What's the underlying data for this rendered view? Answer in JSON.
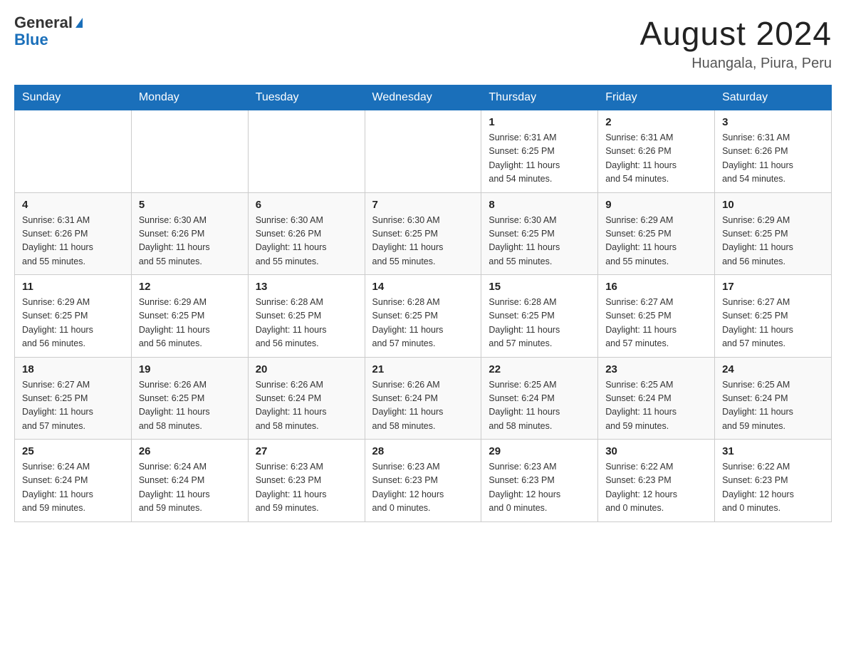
{
  "header": {
    "logo_general": "General",
    "logo_blue": "Blue",
    "month": "August 2024",
    "location": "Huangala, Piura, Peru"
  },
  "weekdays": [
    "Sunday",
    "Monday",
    "Tuesday",
    "Wednesday",
    "Thursday",
    "Friday",
    "Saturday"
  ],
  "weeks": [
    [
      {
        "day": "",
        "info": ""
      },
      {
        "day": "",
        "info": ""
      },
      {
        "day": "",
        "info": ""
      },
      {
        "day": "",
        "info": ""
      },
      {
        "day": "1",
        "info": "Sunrise: 6:31 AM\nSunset: 6:25 PM\nDaylight: 11 hours\nand 54 minutes."
      },
      {
        "day": "2",
        "info": "Sunrise: 6:31 AM\nSunset: 6:26 PM\nDaylight: 11 hours\nand 54 minutes."
      },
      {
        "day": "3",
        "info": "Sunrise: 6:31 AM\nSunset: 6:26 PM\nDaylight: 11 hours\nand 54 minutes."
      }
    ],
    [
      {
        "day": "4",
        "info": "Sunrise: 6:31 AM\nSunset: 6:26 PM\nDaylight: 11 hours\nand 55 minutes."
      },
      {
        "day": "5",
        "info": "Sunrise: 6:30 AM\nSunset: 6:26 PM\nDaylight: 11 hours\nand 55 minutes."
      },
      {
        "day": "6",
        "info": "Sunrise: 6:30 AM\nSunset: 6:26 PM\nDaylight: 11 hours\nand 55 minutes."
      },
      {
        "day": "7",
        "info": "Sunrise: 6:30 AM\nSunset: 6:25 PM\nDaylight: 11 hours\nand 55 minutes."
      },
      {
        "day": "8",
        "info": "Sunrise: 6:30 AM\nSunset: 6:25 PM\nDaylight: 11 hours\nand 55 minutes."
      },
      {
        "day": "9",
        "info": "Sunrise: 6:29 AM\nSunset: 6:25 PM\nDaylight: 11 hours\nand 55 minutes."
      },
      {
        "day": "10",
        "info": "Sunrise: 6:29 AM\nSunset: 6:25 PM\nDaylight: 11 hours\nand 56 minutes."
      }
    ],
    [
      {
        "day": "11",
        "info": "Sunrise: 6:29 AM\nSunset: 6:25 PM\nDaylight: 11 hours\nand 56 minutes."
      },
      {
        "day": "12",
        "info": "Sunrise: 6:29 AM\nSunset: 6:25 PM\nDaylight: 11 hours\nand 56 minutes."
      },
      {
        "day": "13",
        "info": "Sunrise: 6:28 AM\nSunset: 6:25 PM\nDaylight: 11 hours\nand 56 minutes."
      },
      {
        "day": "14",
        "info": "Sunrise: 6:28 AM\nSunset: 6:25 PM\nDaylight: 11 hours\nand 57 minutes."
      },
      {
        "day": "15",
        "info": "Sunrise: 6:28 AM\nSunset: 6:25 PM\nDaylight: 11 hours\nand 57 minutes."
      },
      {
        "day": "16",
        "info": "Sunrise: 6:27 AM\nSunset: 6:25 PM\nDaylight: 11 hours\nand 57 minutes."
      },
      {
        "day": "17",
        "info": "Sunrise: 6:27 AM\nSunset: 6:25 PM\nDaylight: 11 hours\nand 57 minutes."
      }
    ],
    [
      {
        "day": "18",
        "info": "Sunrise: 6:27 AM\nSunset: 6:25 PM\nDaylight: 11 hours\nand 57 minutes."
      },
      {
        "day": "19",
        "info": "Sunrise: 6:26 AM\nSunset: 6:25 PM\nDaylight: 11 hours\nand 58 minutes."
      },
      {
        "day": "20",
        "info": "Sunrise: 6:26 AM\nSunset: 6:24 PM\nDaylight: 11 hours\nand 58 minutes."
      },
      {
        "day": "21",
        "info": "Sunrise: 6:26 AM\nSunset: 6:24 PM\nDaylight: 11 hours\nand 58 minutes."
      },
      {
        "day": "22",
        "info": "Sunrise: 6:25 AM\nSunset: 6:24 PM\nDaylight: 11 hours\nand 58 minutes."
      },
      {
        "day": "23",
        "info": "Sunrise: 6:25 AM\nSunset: 6:24 PM\nDaylight: 11 hours\nand 59 minutes."
      },
      {
        "day": "24",
        "info": "Sunrise: 6:25 AM\nSunset: 6:24 PM\nDaylight: 11 hours\nand 59 minutes."
      }
    ],
    [
      {
        "day": "25",
        "info": "Sunrise: 6:24 AM\nSunset: 6:24 PM\nDaylight: 11 hours\nand 59 minutes."
      },
      {
        "day": "26",
        "info": "Sunrise: 6:24 AM\nSunset: 6:24 PM\nDaylight: 11 hours\nand 59 minutes."
      },
      {
        "day": "27",
        "info": "Sunrise: 6:23 AM\nSunset: 6:23 PM\nDaylight: 11 hours\nand 59 minutes."
      },
      {
        "day": "28",
        "info": "Sunrise: 6:23 AM\nSunset: 6:23 PM\nDaylight: 12 hours\nand 0 minutes."
      },
      {
        "day": "29",
        "info": "Sunrise: 6:23 AM\nSunset: 6:23 PM\nDaylight: 12 hours\nand 0 minutes."
      },
      {
        "day": "30",
        "info": "Sunrise: 6:22 AM\nSunset: 6:23 PM\nDaylight: 12 hours\nand 0 minutes."
      },
      {
        "day": "31",
        "info": "Sunrise: 6:22 AM\nSunset: 6:23 PM\nDaylight: 12 hours\nand 0 minutes."
      }
    ]
  ]
}
